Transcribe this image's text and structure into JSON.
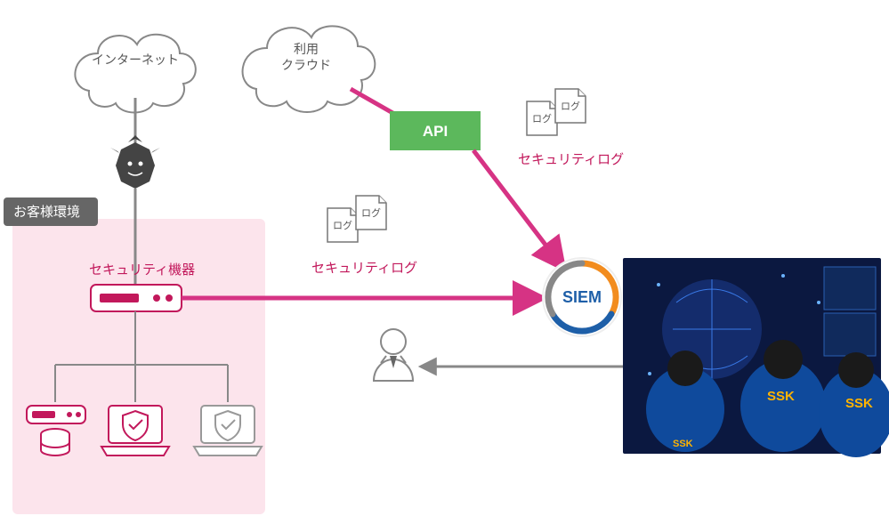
{
  "labels": {
    "internet": "インターネット",
    "cloud_line1": "利用",
    "cloud_line2": "クラウド",
    "api": "API",
    "customer_env": "お客様環境",
    "sec_device": "セキュリティ機器",
    "sec_log": "セキュリティログ",
    "log_small": "ログ",
    "siem": "SIEM",
    "soc_brand": "SSK"
  },
  "colors": {
    "pink": "#c2185b",
    "pink_line": "#d63384",
    "green": "#5cb85c",
    "gray": "#888888",
    "blue": "#1e5fa8",
    "orange": "#f28c1e"
  }
}
